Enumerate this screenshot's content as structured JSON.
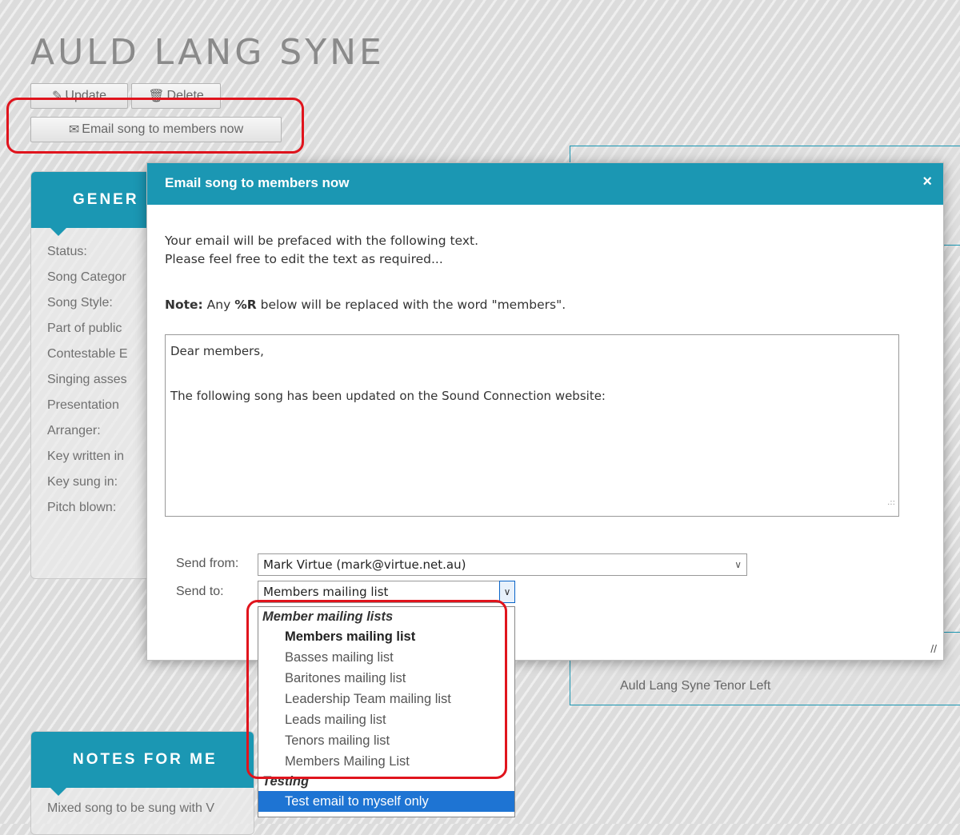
{
  "page": {
    "title": "AULD LANG SYNE",
    "buttons": {
      "update": "Update",
      "delete": "Delete",
      "email": "Email song to members now"
    }
  },
  "general_panel": {
    "header": "GENER",
    "fields": [
      "Status:",
      "Song Categor",
      "Song Style:",
      "Part of public",
      "Contestable E",
      "Singing asses",
      "Presentation",
      "Arranger:",
      "Key written in",
      "Key sung in:",
      "Pitch blown:"
    ]
  },
  "notes_panel": {
    "header": "NOTES FOR ME",
    "text": "Mixed song to be sung with V"
  },
  "right_panel": {
    "item": "Auld Lang Syne Tenor Left"
  },
  "modal": {
    "title": "Email song to members now",
    "close": "×",
    "intro_line1": "Your email will be prefaced with the following text.",
    "intro_line2": "Please feel free to edit the text as required...",
    "note_label": "Note:",
    "note_mid": " Any ",
    "note_token": "%R",
    "note_rest": " below will be replaced with the word \"members\".",
    "message": "Dear members,\n\nThe following song has been updated on the Sound Connection website:",
    "send_from_label": "Send from:",
    "send_from_value": "Mark Virtue (mark@virtue.net.au)",
    "send_to_label": "Send to:",
    "send_to_value": "Members mailing list"
  },
  "dropdown": {
    "groups": [
      {
        "label": "Member mailing lists",
        "options": [
          "Members mailing list",
          "Basses mailing list",
          "Baritones mailing list",
          "Leadership Team mailing list",
          "Leads mailing list",
          "Tenors mailing list",
          "Members Mailing List"
        ]
      },
      {
        "label": "Testing",
        "options": [
          "Test email to myself only"
        ]
      }
    ]
  },
  "colors": {
    "accent": "#1b97b3",
    "highlight": "#e0141d",
    "selection": "#1e74d3"
  }
}
